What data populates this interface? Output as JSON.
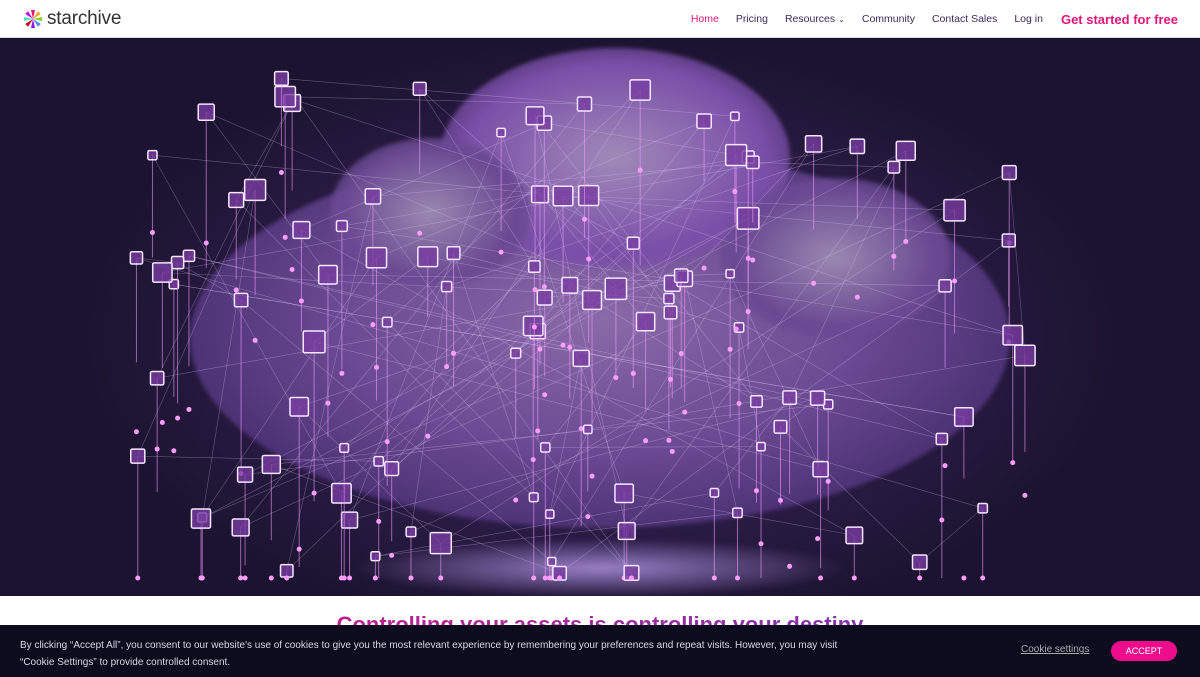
{
  "header": {
    "brand": "starchive",
    "nav": [
      {
        "label": "Home",
        "active": true
      },
      {
        "label": "Pricing"
      },
      {
        "label": "Resources",
        "dropdown": true
      },
      {
        "label": "Community"
      },
      {
        "label": "Contact Sales"
      },
      {
        "label": "Log in"
      }
    ],
    "cta": "Get started for free"
  },
  "main": {
    "headline": "Controlling your assets is controlling your destiny"
  },
  "cookie_banner": {
    "text": "By clicking “Accept All”, you consent to our website's use of cookies to give you the most relevant experience by remembering your preferences and repeat visits. However, you may visit “Cookie Settings” to provide controlled consent.",
    "settings_label": "Cookie settings",
    "accept_label": "ACCEPT"
  },
  "colors": {
    "accent": "#e4147a",
    "banner_bg": "#0d0b1e",
    "accept_bg": "#ec0c8c"
  }
}
